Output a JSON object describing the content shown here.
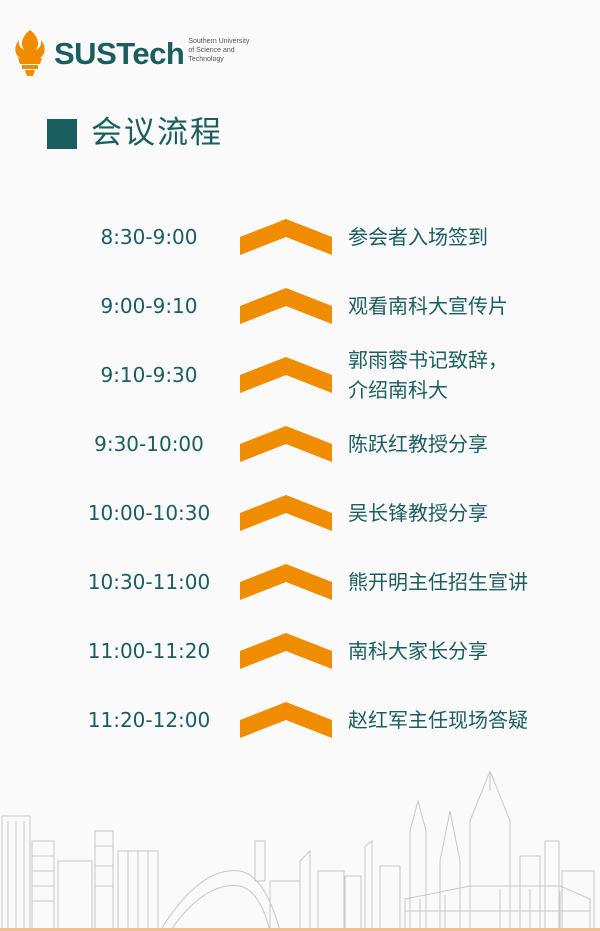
{
  "logo": {
    "wordmark_part1": "SUS",
    "wordmark_part2": "Tech",
    "subtitle_line1": "Southern University",
    "subtitle_line2": "of Science and",
    "subtitle_line3": "Technology",
    "icon": "torch-logo-icon"
  },
  "title": "会议流程",
  "colors": {
    "teal": "#1a5e5f",
    "orange": "#ef8c00",
    "skyline_gray": "#c8c8c8"
  },
  "schedule": [
    {
      "time": "8:30-9:00",
      "desc": "参会者入场签到"
    },
    {
      "time": "9:00-9:10",
      "desc": "观看南科大宣传片"
    },
    {
      "time": "9:10-9:30",
      "desc_line1": "郭雨蓉书记致辞，",
      "desc_line2": "介绍南科大"
    },
    {
      "time": "9:30-10:00",
      "desc": "陈跃红教授分享"
    },
    {
      "time": "10:00-10:30",
      "desc": "吴长锋教授分享"
    },
    {
      "time": "10:30-11:00",
      "desc": "熊开明主任招生宣讲"
    },
    {
      "time": "11:00-11:20",
      "desc": "南科大家长分享"
    },
    {
      "time": "11:20-12:00",
      "desc": "赵红军主任现场答疑"
    }
  ],
  "decor": {
    "row_marker_icon": "chevron-up-icon",
    "footer_illustration": "city-skyline-illustration"
  }
}
